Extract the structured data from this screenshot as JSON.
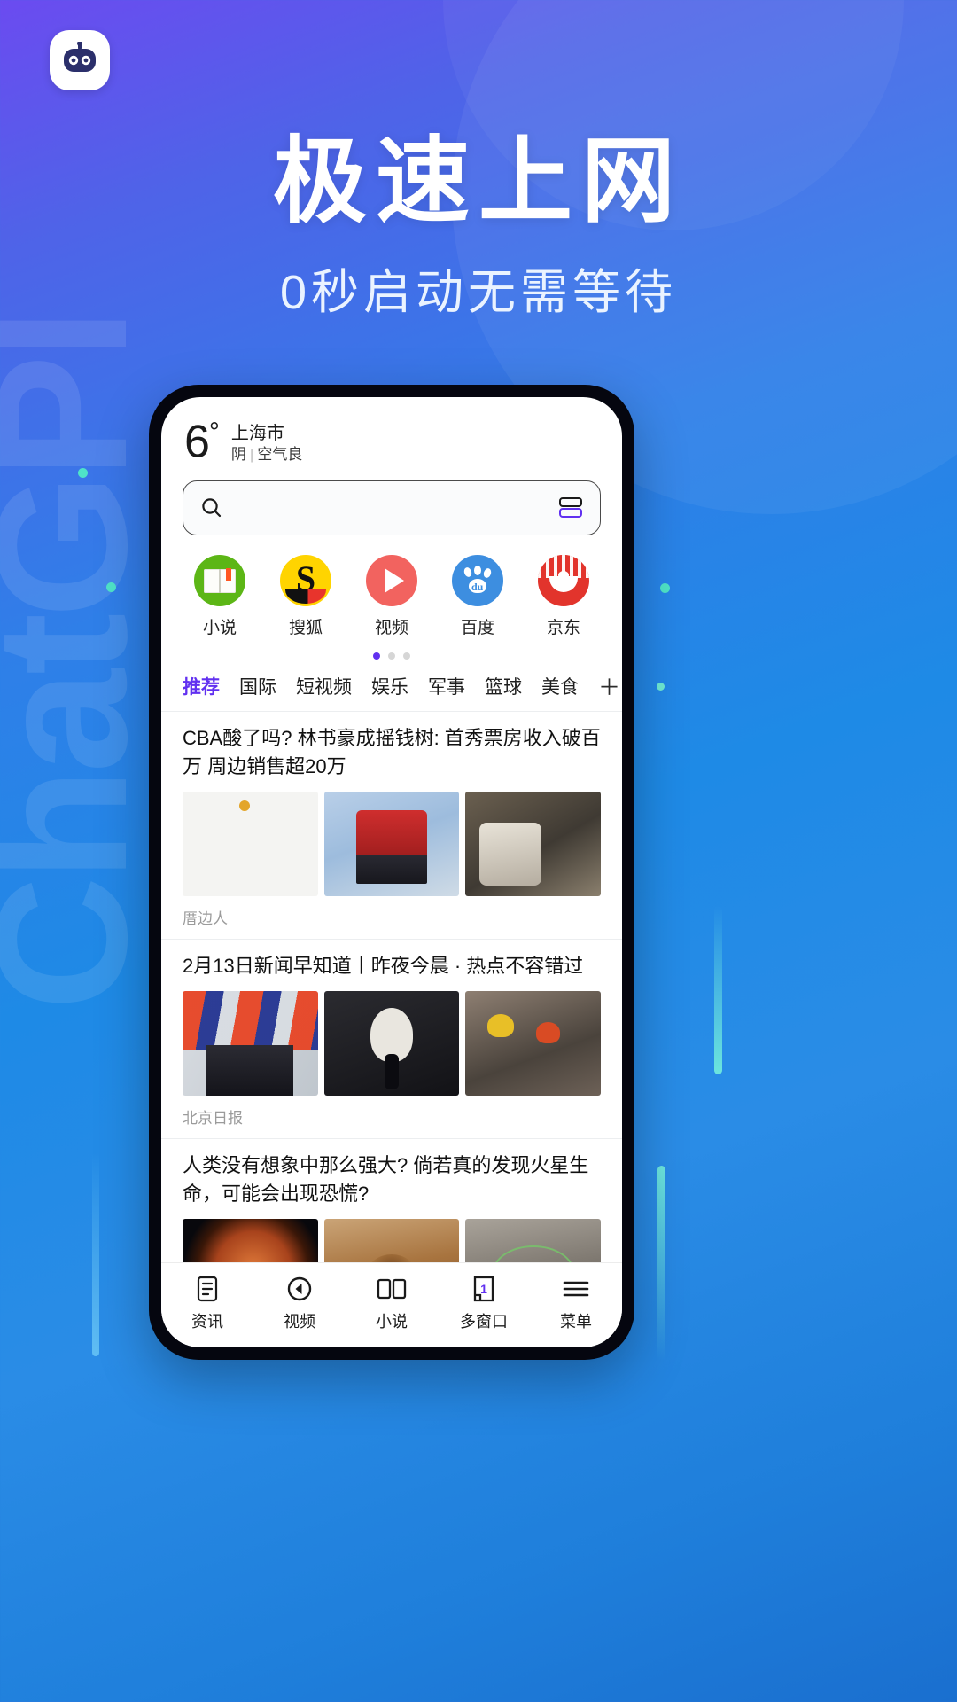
{
  "hero": {
    "title": "极速上网",
    "subtitle": "0秒启动无需等待",
    "logo_icon": "robot-icon",
    "watermark": "ChatGPI"
  },
  "phone": {
    "weather": {
      "temperature": "6",
      "degree_symbol": "°",
      "city": "上海市",
      "condition": "阴",
      "separator": "|",
      "air_quality": "空气良"
    },
    "search": {
      "icon": "search-icon",
      "placeholder": "",
      "value": "",
      "right_icon": "multi-window-icon"
    },
    "shortcuts": [
      {
        "label": "小说",
        "icon": "novel-book-icon"
      },
      {
        "label": "搜狐",
        "icon": "sohu-icon"
      },
      {
        "label": "视频",
        "icon": "video-play-icon"
      },
      {
        "label": "百度",
        "icon": "baidu-paw-icon"
      },
      {
        "label": "京东",
        "icon": "jingdong-icon"
      }
    ],
    "pager": {
      "count": 3,
      "active_index": 0
    },
    "tabs": [
      {
        "label": "推荐",
        "active": true
      },
      {
        "label": "国际",
        "active": false
      },
      {
        "label": "短视频",
        "active": false
      },
      {
        "label": "娱乐",
        "active": false
      },
      {
        "label": "军事",
        "active": false
      },
      {
        "label": "篮球",
        "active": false
      },
      {
        "label": "美食",
        "active": false
      }
    ],
    "tab_add_icon": "＋",
    "news": [
      {
        "title": "CBA酸了吗? 林书豪成摇钱树: 首秀票房收入破百万 周边销售超20万",
        "source": "厝边人",
        "thumbs": [
          "t-doc",
          "t-red",
          "t-bus"
        ]
      },
      {
        "title": "2月13日新闻早知道丨昨夜今晨 · 热点不容错过",
        "source": "北京日报",
        "thumbs": [
          "t-flag",
          "t-speak",
          "t-rescue"
        ]
      },
      {
        "title": "人类没有想象中那么强大? 倘若真的发现火星生命，可能会出现恐慌?",
        "source": "",
        "thumbs": [
          "t-mars1",
          "t-mars2",
          "t-moon"
        ]
      }
    ],
    "bottom_nav": [
      {
        "label": "资讯",
        "icon": "news-doc-icon",
        "badge": ""
      },
      {
        "label": "视频",
        "icon": "back-circle-icon",
        "badge": ""
      },
      {
        "label": "小说",
        "icon": "open-book-icon",
        "badge": ""
      },
      {
        "label": "多窗口",
        "icon": "window-count-icon",
        "badge": "1"
      },
      {
        "label": "菜单",
        "icon": "hamburger-menu-icon",
        "badge": ""
      }
    ]
  },
  "colors": {
    "accent_purple": "#6130f0",
    "bg_blue": "#2f7fe8",
    "text_dark": "#1b1b1b"
  }
}
